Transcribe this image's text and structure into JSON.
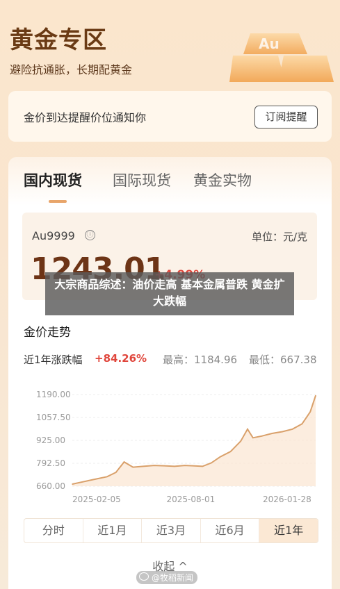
{
  "header": {
    "title": "黄金专区",
    "subtitle": "避险抗通胀，长期配黄金"
  },
  "alert": {
    "text": "金价到达提醒价位通知你",
    "button_label": "订阅提醒"
  },
  "tabs": [
    {
      "label": "国内现货",
      "active": true
    },
    {
      "label": "国际现货",
      "active": false
    },
    {
      "label": "黄金实物",
      "active": false
    }
  ],
  "price": {
    "code": "Au9999",
    "info_icon": "ⓘ",
    "unit": "单位：元/克",
    "value": "1243.01",
    "change": "+4.99%"
  },
  "overlay": {
    "headline": "大宗商品综述：油价走高 基本金属普跌 黄金扩大跌幅"
  },
  "trend": {
    "title": "金价走势",
    "period_label": "近1年涨跌幅",
    "period_change": "+84.26%",
    "high": "最高：1184.96",
    "low": "最低：667.38"
  },
  "chart_data": {
    "type": "area",
    "ylim": [
      660,
      1190
    ],
    "y_ticks": [
      "1190.00",
      "1057.50",
      "925.00",
      "792.50",
      "660.00"
    ],
    "x_ticks": [
      "2025-02-05",
      "2025-08-01",
      "2026-01-28"
    ],
    "x": [
      "2025-02-05",
      "2025-02-20",
      "2025-03-10",
      "2025-03-28",
      "2025-04-10",
      "2025-04-22",
      "2025-05-05",
      "2025-05-20",
      "2025-06-05",
      "2025-06-20",
      "2025-07-05",
      "2025-07-20",
      "2025-08-01",
      "2025-08-15",
      "2025-08-28",
      "2025-09-10",
      "2025-09-25",
      "2025-10-10",
      "2025-10-20",
      "2025-10-28",
      "2025-11-10",
      "2025-11-25",
      "2025-12-10",
      "2025-12-25",
      "2026-01-08",
      "2026-01-20",
      "2026-01-28"
    ],
    "values": [
      672,
      685,
      700,
      715,
      740,
      800,
      770,
      775,
      780,
      778,
      775,
      780,
      778,
      775,
      795,
      830,
      860,
      920,
      990,
      940,
      950,
      965,
      975,
      990,
      1020,
      1090,
      1184
    ],
    "line_color": "#d9a06a",
    "fill_color": "#fbe6d2"
  },
  "ranges": [
    {
      "label": "分时",
      "active": false
    },
    {
      "label": "近1月",
      "active": false
    },
    {
      "label": "近3月",
      "active": false
    },
    {
      "label": "近6月",
      "active": false
    },
    {
      "label": "近1年",
      "active": true
    }
  ],
  "collapse_label": "收起 ^",
  "watermark": "@牧稻新闻"
}
